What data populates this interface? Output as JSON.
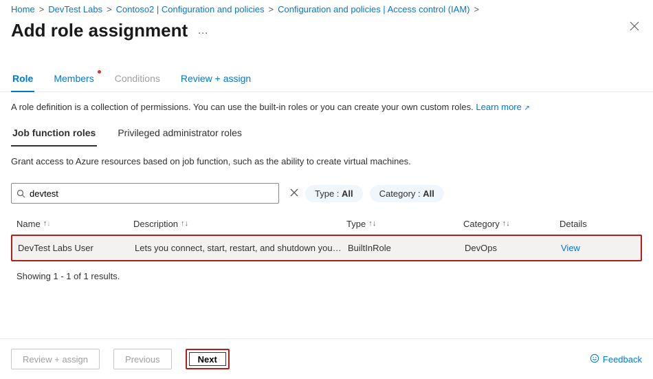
{
  "breadcrumb": {
    "items": [
      "Home",
      "DevTest Labs",
      "Contoso2 | Configuration and policies",
      "Configuration and policies | Access control (IAM)"
    ]
  },
  "page": {
    "title": "Add role assignment"
  },
  "tabs": [
    {
      "label": "Role",
      "selected": true
    },
    {
      "label": "Members",
      "dot": true
    },
    {
      "label": "Conditions",
      "disabled": true
    },
    {
      "label": "Review + assign"
    }
  ],
  "intro": {
    "text": "A role definition is a collection of permissions. You can use the built-in roles or you can create your own custom roles.",
    "learn_more": "Learn more"
  },
  "subtabs": [
    {
      "label": "Job function roles",
      "selected": true
    },
    {
      "label": "Privileged administrator roles"
    }
  ],
  "grant_text": "Grant access to Azure resources based on job function, such as the ability to create virtual machines.",
  "filters": {
    "search_value": "devtest",
    "type": {
      "label": "Type :",
      "value": "All"
    },
    "category": {
      "label": "Category :",
      "value": "All"
    }
  },
  "table": {
    "columns": [
      "Name",
      "Description",
      "Type",
      "Category",
      "Details"
    ],
    "rows": [
      {
        "name": "DevTest Labs User",
        "description": "Lets you connect, start, restart, and shutdown your vir…",
        "type": "BuiltInRole",
        "category": "DevOps",
        "details": "View"
      }
    ]
  },
  "results_text": "Showing 1 - 1 of 1 results.",
  "footer": {
    "review": "Review + assign",
    "previous": "Previous",
    "next": "Next",
    "feedback": "Feedback"
  }
}
